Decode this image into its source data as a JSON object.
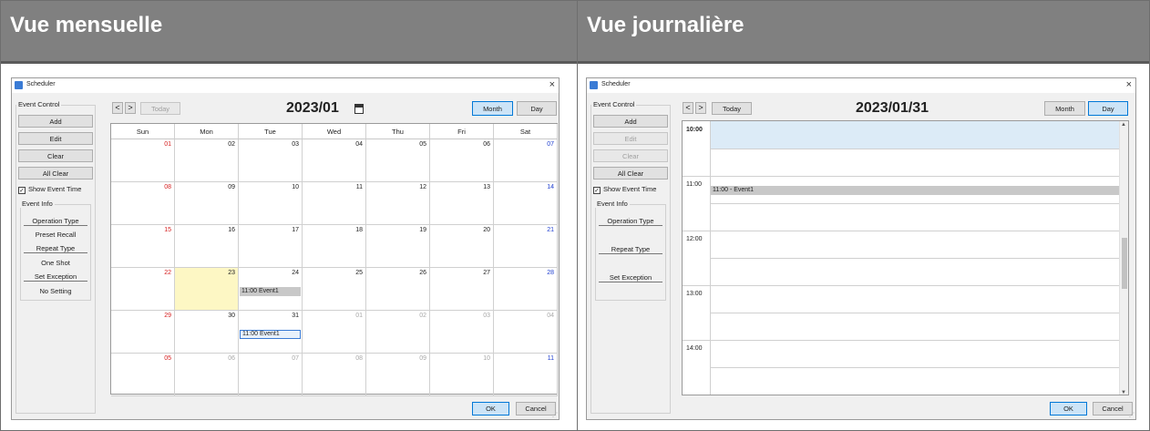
{
  "columns": {
    "left_heading": "Vue mensuelle",
    "right_heading": "Vue journalière"
  },
  "colors": {
    "header_bg": "#808080",
    "today_highlight": "#fdf7c4",
    "sunday": "#d62020",
    "saturday": "#2040d0",
    "selected_hour": "#dcebf7",
    "event_bg": "#c8c8c8",
    "active_button": "#cce4f7"
  },
  "month_window": {
    "title": "Scheduler",
    "close_icon": "×",
    "event_control": {
      "label": "Event Control",
      "add": "Add",
      "edit": "Edit",
      "clear": "Clear",
      "all_clear": "All Clear",
      "show_event_time": "Show Event Time",
      "show_event_time_checked": true
    },
    "event_info": {
      "label": "Event Info",
      "operation_type_label": "Operation Type",
      "operation_type_value": "Preset Recall",
      "repeat_type_label": "Repeat Type",
      "repeat_type_value": "One Shot",
      "set_exception_label": "Set Exception",
      "set_exception_value": "No Setting"
    },
    "nav": {
      "prev": "<",
      "next": ">",
      "today": "Today",
      "today_enabled": false
    },
    "date_title": "2023/01",
    "calendar_icon": "calendar-icon",
    "view_buttons": {
      "month": "Month",
      "day": "Day",
      "active": "month"
    },
    "weekdays": [
      "Sun",
      "Mon",
      "Tue",
      "Wed",
      "Thu",
      "Fri",
      "Sat"
    ],
    "weeks": [
      [
        "01",
        "02",
        "03",
        "04",
        "05",
        "06",
        "07"
      ],
      [
        "08",
        "09",
        "10",
        "11",
        "12",
        "13",
        "14"
      ],
      [
        "15",
        "16",
        "17",
        "18",
        "19",
        "20",
        "21"
      ],
      [
        "22",
        "23",
        "24",
        "25",
        "26",
        "27",
        "28"
      ],
      [
        "29",
        "30",
        "31",
        "01",
        "02",
        "03",
        "04"
      ],
      [
        "05",
        "06",
        "07",
        "08",
        "09",
        "10",
        "11"
      ]
    ],
    "today_cell": "23",
    "events": [
      {
        "label": "11:00 Event1",
        "week": 3,
        "day": 2,
        "selected": false
      },
      {
        "label": "11:00 Event1",
        "week": 4,
        "day": 2,
        "selected": true
      }
    ],
    "ok": "OK",
    "cancel": "Cancel"
  },
  "day_window": {
    "title": "Scheduler",
    "close_icon": "×",
    "event_control": {
      "label": "Event Control",
      "add": "Add",
      "edit": "Edit",
      "clear": "Clear",
      "all_clear": "All Clear",
      "show_event_time": "Show Event Time",
      "show_event_time_checked": true
    },
    "event_info": {
      "label": "Event Info",
      "operation_type_label": "Operation Type",
      "repeat_type_label": "Repeat Type",
      "set_exception_label": "Set Exception"
    },
    "nav": {
      "prev": "<",
      "next": ">",
      "today": "Today",
      "today_enabled": true
    },
    "date_title": "2023/01/31",
    "view_buttons": {
      "month": "Month",
      "day": "Day",
      "active": "day"
    },
    "time_labels": [
      "10:00",
      "11:00",
      "12:00",
      "13:00",
      "14:00"
    ],
    "selected_hour": "10:00",
    "event": "11:00 - Event1",
    "ok": "OK",
    "cancel": "Cancel"
  }
}
